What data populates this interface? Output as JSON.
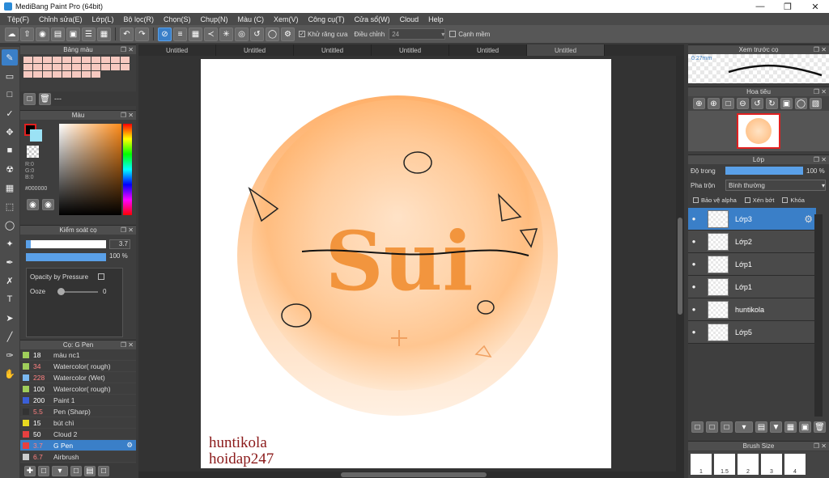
{
  "window": {
    "title": "MediBang Paint Pro (64bit)"
  },
  "menu": [
    "Tệp(F)",
    "Chỉnh sửa(E)",
    "Lớp(L)",
    "Bộ lọc(R)",
    "Chọn(S)",
    "Chụp(N)",
    "Màu (C)",
    "Xem(V)",
    "Công cụ(T)",
    "Cửa sổ(W)",
    "Cloud",
    "Help"
  ],
  "toolbar": {
    "antialias_label": "Khử răng cưa",
    "adjust_label": "Điều chỉnh",
    "adjust_value": "24",
    "sharp_edges_label": "Cạnh mềm"
  },
  "tabs": [
    "Untitled",
    "Untitled",
    "Untitled",
    "Untitled",
    "Untitled",
    "Untitled"
  ],
  "palette": {
    "title": "Bảng màu",
    "swatches": [
      "#f7c9c0",
      "#f7c9c0",
      "#f7c9c0",
      "#f7c9c0",
      "#f7c9c0",
      "#f7c9c0",
      "#f7c9c0",
      "#f7c9c0",
      "#f7c9c0",
      "#f7c9c0",
      "#f7c9c0",
      "#f7c9c0",
      "#f7c9c0",
      "#f7c9c0",
      "#f7c9c0",
      "#f7c9c0",
      "#f7c9c0",
      "#f7c9c0",
      "#f7c9c0",
      "#f7c9c0",
      "#f7c9c0",
      "#f7c9c0",
      "#f7c9c0",
      "#f7c9c0",
      "#f7c9c0",
      "#f7c9c0",
      "#f7c9c0",
      "#f7c9c0",
      "#f7c9c0",
      "#f7c9c0"
    ],
    "footer_text": "---"
  },
  "color": {
    "title": "Màu",
    "r": "R:0",
    "g": "G:0",
    "b": "B:0",
    "hex": "#000000"
  },
  "brush_control": {
    "title": "Kiểm soát cọ",
    "size": "3.7",
    "opacity": "100 %",
    "opacity_by_pressure": "Opacity by Pressure",
    "ooze_label": "Ooze",
    "ooze_value": "0"
  },
  "brushes": {
    "title": "Cọ: G Pen",
    "items": [
      {
        "num": "18",
        "name": "màu nc1",
        "color": "#9fce5a"
      },
      {
        "num": "34",
        "name": "Watercolor( rough)",
        "color": "#9fce5a"
      },
      {
        "num": "228",
        "name": "Watercolor (Wet)",
        "color": "#7ab8f0"
      },
      {
        "num": "100",
        "name": "Watercolor( rough)",
        "color": "#9fce5a"
      },
      {
        "num": "200",
        "name": "Paint 1",
        "color": "#3a5fd8"
      },
      {
        "num": "5.5",
        "name": "Pen (Sharp)",
        "color": "#333333"
      },
      {
        "num": "15",
        "name": "bút chì",
        "color": "#e8d820"
      },
      {
        "num": "50",
        "name": "Cloud 2",
        "color": "#e84040"
      },
      {
        "num": "3.7",
        "name": "G Pen",
        "color": "#e84040"
      },
      {
        "num": "6.7",
        "name": "Airbrush",
        "color": "#cccccc"
      }
    ]
  },
  "preview": {
    "title": "Xem trước cọ",
    "size": "0.27mm"
  },
  "navigator": {
    "title": "Hoa tiêu"
  },
  "layers": {
    "title": "Lớp",
    "opacity_label": "Độ trong",
    "opacity_value": "100 %",
    "blend_label": "Pha trộn",
    "blend_value": "Bình thường",
    "protect_alpha": "Bảo vệ alpha",
    "clipping": "Xén bớt",
    "lock": "Khóa",
    "items": [
      "Lớp3",
      "Lớp2",
      "Lớp1",
      "Lớp1",
      "huntikola",
      "Lớp5"
    ]
  },
  "brush_size": {
    "title": "Brush Size",
    "values": [
      "1",
      "1.5",
      "2",
      "3",
      "4"
    ]
  },
  "artwork": {
    "text": "Sui"
  },
  "watermark": {
    "line1": "huntikola",
    "line2": "hoidap247"
  }
}
